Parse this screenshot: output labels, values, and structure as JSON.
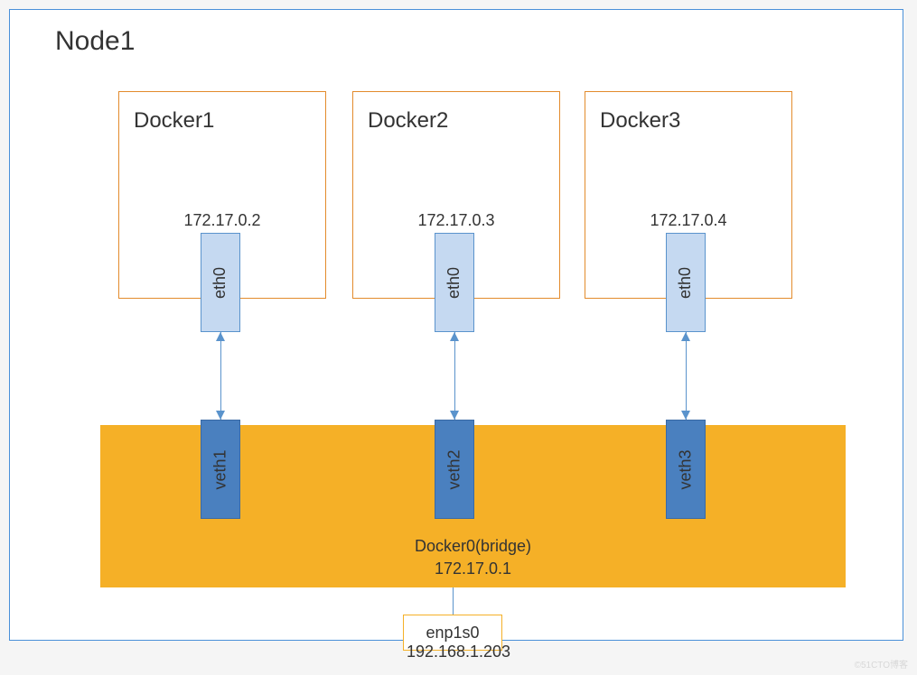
{
  "node": {
    "title": "Node1"
  },
  "containers": [
    {
      "name": "Docker1",
      "ip": "172.17.0.2",
      "iface": "eth0",
      "veth": "veth1"
    },
    {
      "name": "Docker2",
      "ip": "172.17.0.3",
      "iface": "eth0",
      "veth": "veth2"
    },
    {
      "name": "Docker3",
      "ip": "172.17.0.4",
      "iface": "eth0",
      "veth": "veth3"
    }
  ],
  "bridge": {
    "name": "Docker0(bridge)",
    "ip": "172.17.0.1"
  },
  "host_nic": {
    "name": "enp1s0",
    "ip": "192.168.1.203"
  },
  "watermark": "©51CTO博客"
}
